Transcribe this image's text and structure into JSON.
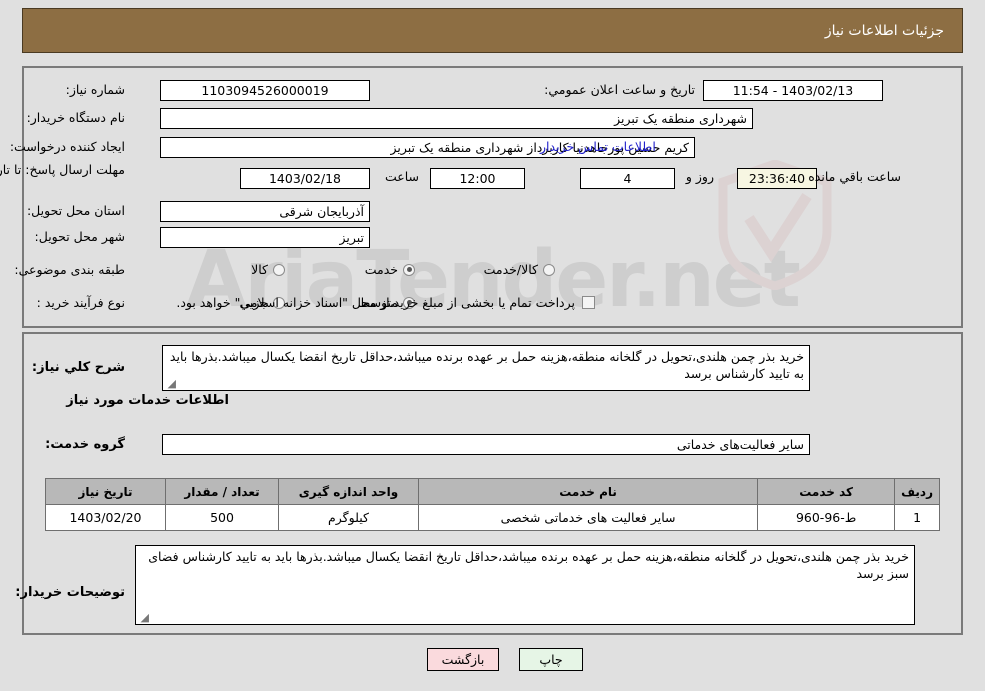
{
  "header": {
    "title": "جزئیات اطلاعات نیاز"
  },
  "watermark": {
    "text": "AriaTender.net"
  },
  "fields": {
    "need_number": {
      "label": "شماره نیاز:",
      "value": "1103094526000019"
    },
    "announce_datetime": {
      "label": "تاریخ و ساعت اعلان عمومي:",
      "value": "1403/02/13 - 11:54"
    },
    "buyer_org": {
      "label": "نام دستگاه خریدار:",
      "value": "شهرداری منطقه یک تبریز"
    },
    "requester": {
      "label": "ایجاد کننده درخواست:",
      "value": "کریم حسین پورجاهدنیا کاربرداز شهرداری منطقه یک تبریز"
    },
    "buyer_contact_link": "اطلاعات تماس خریدار",
    "deadline": {
      "label": "مهلت ارسال پاسخ: تا تاریخ:",
      "date": "1403/02/18",
      "time_label": "ساعت",
      "time": "12:00",
      "days": "4",
      "days_label": "روز و",
      "countdown": "23:36:40",
      "countdown_label": "ساعت باقي مانده"
    },
    "province": {
      "label": "استان محل تحویل:",
      "value": "آذربایجان شرقی"
    },
    "city": {
      "label": "شهر محل تحویل:",
      "value": "تبریز"
    },
    "category": {
      "label": "طبقه بندی موضوعی:",
      "options": [
        "کالا",
        "خدمت",
        "کالا/خدمت"
      ],
      "selected": "خدمت"
    },
    "process_type": {
      "label": "نوع فرآیند خرید :",
      "options": [
        "جزیي",
        "متوسط"
      ],
      "selected": "متوسط",
      "treasury_checkbox_label": "پرداخت تمام یا بخشی از مبلغ خرید،از محل \"اسناد خزانه اسلامی\" خواهد بود.",
      "treasury_checked": false
    }
  },
  "description": {
    "label": "شرح کلي نیاز:",
    "value": "خرید بذر چمن هلندی،تحویل در گلخانه منطقه،هزینه حمل بر عهده برنده میباشد،حداقل تاریخ انقضا یکسال میباشد.بذرها باید به تایید کارشناس برسد"
  },
  "services_section": {
    "title": "اطلاعات خدمات مورد نیاز",
    "group_label": "گروه خدمت:",
    "group_value": "سایر فعالیت‌های خدماتی"
  },
  "table": {
    "columns": [
      "ردیف",
      "کد خدمت",
      "نام خدمت",
      "واحد اندازه گیری",
      "تعداد / مقدار",
      "تاریخ نیاز"
    ],
    "rows": [
      {
        "row_no": "1",
        "service_code": "ط-96-960",
        "service_name": "سایر فعالیت های خدماتی شخصی",
        "unit": "کیلوگرم",
        "quantity": "500",
        "need_date": "1403/02/20"
      }
    ]
  },
  "buyer_notes": {
    "label": "توضیحات خریدار:",
    "value": "خرید بذر چمن هلندی،تحویل در گلخانه منطقه،هزینه حمل بر عهده برنده میباشد،حداقل تاریخ انقضا یکسال میباشد.بذرها باید به تایید کارشناس فضای سبز برسد"
  },
  "footer": {
    "print_label": "چاپ",
    "back_label": "بازگشت"
  },
  "colors": {
    "header_brown": "#8d6e43",
    "page_bg": "#e0e0e0",
    "panel_border": "#7a7a7a",
    "table_header": "#b8b8b8",
    "link_blue": "#2222cc",
    "countdown_bg": "#f7f6e2",
    "print_btn_bg": "#e6f5e6",
    "back_btn_bg": "#fadadd"
  }
}
